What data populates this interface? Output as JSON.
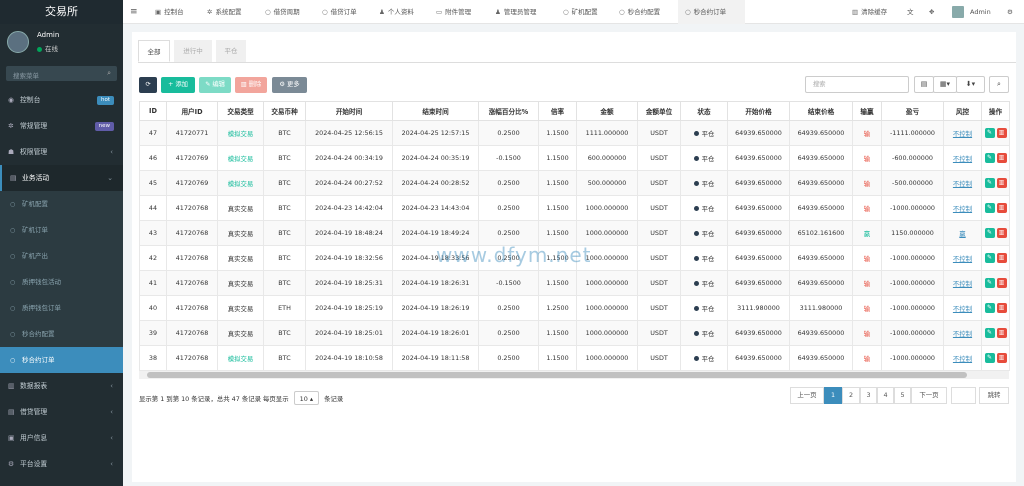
{
  "brand": "交易所",
  "user": {
    "name": "Admin",
    "status": "在线"
  },
  "sidebar": {
    "search_placeholder": "搜索菜单",
    "items": [
      {
        "label": "控制台",
        "badge": "hot",
        "badge_color": "#3c8dbc"
      },
      {
        "label": "常规管理",
        "badge": "new",
        "badge_color": "#605ca8"
      },
      {
        "label": "权限管理"
      },
      {
        "label": "业务活动"
      }
    ],
    "sub_items": [
      "矿机配置",
      "矿机订单",
      "矿机产出",
      "质押钱包活动",
      "质押钱包订单",
      "秒合约配置",
      "秒合约订单"
    ],
    "bottom_items": [
      "数据报表",
      "借贷管理",
      "用户信息",
      "平台设置"
    ]
  },
  "topnav": {
    "tabs": [
      "控制台",
      "系统配置",
      "借贷周期",
      "借贷订单",
      "个人资料",
      "附件管理",
      "管理员管理",
      "矿机配置",
      "秒合约配置",
      "秒合约订单"
    ],
    "clear_cache": "清除缓存",
    "admin": "Admin"
  },
  "subtabs": [
    "全部",
    "进行中",
    "平仓"
  ],
  "toolbar": {
    "add": "添加",
    "edit": "编辑",
    "delete": "删除",
    "more": "更多",
    "search_placeholder": "搜索"
  },
  "table": {
    "headers": [
      "ID",
      "用户ID",
      "交易类型",
      "交易币种",
      "开始时间",
      "结束时间",
      "涨幅百分比%",
      "倍率",
      "金额",
      "金额单位",
      "状态",
      "开始价格",
      "结束价格",
      "输赢",
      "盈亏",
      "风控",
      "操作"
    ],
    "rows": [
      {
        "id": "47",
        "uid": "41720771",
        "type": "模拟交易",
        "coin": "BTC",
        "start": "2024-04-25 12:56:15",
        "end": "2024-04-25 12:57:15",
        "pct": "0.2500",
        "rate": "1.1500",
        "amount": "1111.000000",
        "unit": "USDT",
        "status": "平仓",
        "sp": "64939.650000",
        "ep": "64939.650000",
        "win": "输",
        "pnl": "-1111.000000",
        "risk": "不控制"
      },
      {
        "id": "46",
        "uid": "41720769",
        "type": "模拟交易",
        "coin": "BTC",
        "start": "2024-04-24 00:34:19",
        "end": "2024-04-24 00:35:19",
        "pct": "-0.1500",
        "rate": "1.1500",
        "amount": "600.000000",
        "unit": "USDT",
        "status": "平仓",
        "sp": "64939.650000",
        "ep": "64939.650000",
        "win": "输",
        "pnl": "-600.000000",
        "risk": "不控制"
      },
      {
        "id": "45",
        "uid": "41720769",
        "type": "模拟交易",
        "coin": "BTC",
        "start": "2024-04-24 00:27:52",
        "end": "2024-04-24 00:28:52",
        "pct": "0.2500",
        "rate": "1.1500",
        "amount": "500.000000",
        "unit": "USDT",
        "status": "平仓",
        "sp": "64939.650000",
        "ep": "64939.650000",
        "win": "输",
        "pnl": "-500.000000",
        "risk": "不控制"
      },
      {
        "id": "44",
        "uid": "41720768",
        "type": "真实交易",
        "coin": "BTC",
        "start": "2024-04-23 14:42:04",
        "end": "2024-04-23 14:43:04",
        "pct": "0.2500",
        "rate": "1.1500",
        "amount": "1000.000000",
        "unit": "USDT",
        "status": "平仓",
        "sp": "64939.650000",
        "ep": "64939.650000",
        "win": "输",
        "pnl": "-1000.000000",
        "risk": "不控制"
      },
      {
        "id": "43",
        "uid": "41720768",
        "type": "真实交易",
        "coin": "BTC",
        "start": "2024-04-19 18:48:24",
        "end": "2024-04-19 18:49:24",
        "pct": "0.2500",
        "rate": "1.1500",
        "amount": "1000.000000",
        "unit": "USDT",
        "status": "平仓",
        "sp": "64939.650000",
        "ep": "65102.161600",
        "win": "赢",
        "pnl": "1150.000000",
        "risk": "赢"
      },
      {
        "id": "42",
        "uid": "41720768",
        "type": "真实交易",
        "coin": "BTC",
        "start": "2024-04-19 18:32:56",
        "end": "2024-04-19 18:33:56",
        "pct": "0.2500",
        "rate": "1.1500",
        "amount": "1000.000000",
        "unit": "USDT",
        "status": "平仓",
        "sp": "64939.650000",
        "ep": "64939.650000",
        "win": "输",
        "pnl": "-1000.000000",
        "risk": "不控制"
      },
      {
        "id": "41",
        "uid": "41720768",
        "type": "真实交易",
        "coin": "BTC",
        "start": "2024-04-19 18:25:31",
        "end": "2024-04-19 18:26:31",
        "pct": "-0.1500",
        "rate": "1.1500",
        "amount": "1000.000000",
        "unit": "USDT",
        "status": "平仓",
        "sp": "64939.650000",
        "ep": "64939.650000",
        "win": "输",
        "pnl": "-1000.000000",
        "risk": "不控制"
      },
      {
        "id": "40",
        "uid": "41720768",
        "type": "真实交易",
        "coin": "ETH",
        "start": "2024-04-19 18:25:19",
        "end": "2024-04-19 18:26:19",
        "pct": "0.2500",
        "rate": "1.2500",
        "amount": "1000.000000",
        "unit": "USDT",
        "status": "平仓",
        "sp": "3111.980000",
        "ep": "3111.980000",
        "win": "输",
        "pnl": "-1000.000000",
        "risk": "不控制"
      },
      {
        "id": "39",
        "uid": "41720768",
        "type": "真实交易",
        "coin": "BTC",
        "start": "2024-04-19 18:25:01",
        "end": "2024-04-19 18:26:01",
        "pct": "0.2500",
        "rate": "1.1500",
        "amount": "1000.000000",
        "unit": "USDT",
        "status": "平仓",
        "sp": "64939.650000",
        "ep": "64939.650000",
        "win": "输",
        "pnl": "-1000.000000",
        "risk": "不控制"
      },
      {
        "id": "38",
        "uid": "41720768",
        "type": "模拟交易",
        "coin": "BTC",
        "start": "2024-04-19 18:10:58",
        "end": "2024-04-19 18:11:58",
        "pct": "0.2500",
        "rate": "1.1500",
        "amount": "1000.000000",
        "unit": "USDT",
        "status": "平仓",
        "sp": "64939.650000",
        "ep": "64939.650000",
        "win": "输",
        "pnl": "-1000.000000",
        "risk": "不控制"
      }
    ]
  },
  "pagination": {
    "info_prefix": "显示第 1 到第 10 条记录，总共 47 条记录 每页显示",
    "page_size": "10",
    "info_suffix": "条记录",
    "prev": "上一页",
    "pages": [
      "1",
      "2",
      "3",
      "4",
      "5"
    ],
    "next": "下一页",
    "jump": "跳转"
  },
  "watermark": "www.dfym.net",
  "colors": {
    "primary": "#3c8dbc",
    "green": "#18bc9c",
    "red": "#e74c3c",
    "sidebar": "#222d32"
  }
}
